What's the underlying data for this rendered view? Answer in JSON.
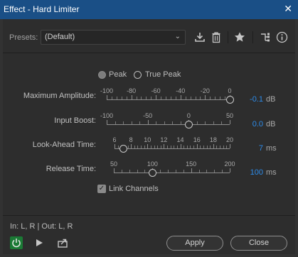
{
  "window": {
    "title": "Effect - Hard Limiter",
    "close_glyph": "✕"
  },
  "presets": {
    "label": "Presets:",
    "selected": "(Default)",
    "chevron": "⌄"
  },
  "toolbar": {
    "icons": [
      "save-preset-icon",
      "delete-preset-icon",
      "favorite-star-icon",
      "routing-icon",
      "info-icon"
    ]
  },
  "mode": {
    "options": [
      {
        "label": "Peak",
        "selected": true
      },
      {
        "label": "True Peak",
        "selected": false
      }
    ]
  },
  "params": [
    {
      "label": "Maximum Amplitude:",
      "ticks": [
        "-100",
        "-80",
        "-60",
        "-40",
        "-20",
        "0"
      ],
      "range": [
        -100,
        0
      ],
      "value": -0.1,
      "value_text": "-0.1",
      "unit": "dB"
    },
    {
      "label": "Input Boost:",
      "ticks": [
        "-100",
        "-50",
        "0",
        "50"
      ],
      "range": [
        -100,
        50
      ],
      "value": 0,
      "value_text": "0.0",
      "unit": "dB"
    },
    {
      "label": "Look-Ahead Time:",
      "ticks": [
        "6",
        "8",
        "10",
        "12",
        "14",
        "16",
        "18",
        "20"
      ],
      "range": [
        6,
        20
      ],
      "value": 7,
      "value_text": "7",
      "unit": "ms"
    },
    {
      "label": "Release Time:",
      "ticks": [
        "50",
        "100",
        "150",
        "200"
      ],
      "range": [
        50,
        200
      ],
      "value": 100,
      "value_text": "100",
      "unit": "ms"
    }
  ],
  "link_channels": {
    "label": "Link Channels",
    "checked": true,
    "check_glyph": "✓"
  },
  "io": {
    "text": "In: L, R | Out: L, R"
  },
  "footer": {
    "apply_label": "Apply",
    "close_label": "Close"
  },
  "colors": {
    "title_bar": "#1a4f86",
    "accent_value": "#2d8ceb",
    "power_on": "#1b7a35"
  }
}
